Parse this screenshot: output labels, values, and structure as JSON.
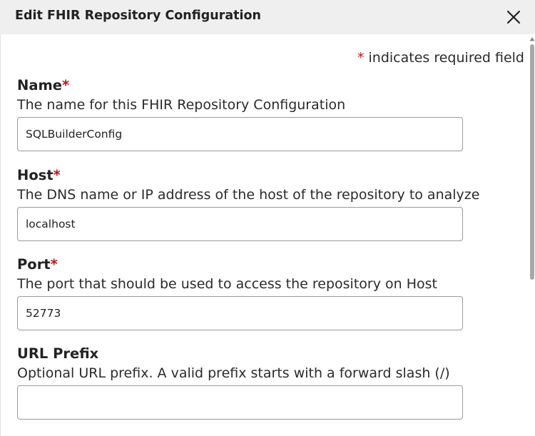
{
  "dialog": {
    "title": "Edit FHIR Repository Configuration",
    "close_icon": "close-icon"
  },
  "required_note": {
    "star": "*",
    "text": " indicates required field"
  },
  "fields": [
    {
      "label": "Name",
      "required_star": "*",
      "description": "The name for this FHIR Repository Configuration",
      "value": "SQLBuilderConfig"
    },
    {
      "label": "Host",
      "required_star": "*",
      "description": "The DNS name or IP address of the host of the repository to analyze",
      "value": "localhost"
    },
    {
      "label": "Port",
      "required_star": "*",
      "description": "The port that should be used to access the repository on Host",
      "value": "52773"
    },
    {
      "label": "URL Prefix",
      "required_star": "",
      "description": "Optional URL prefix. A valid prefix starts with a forward slash (/)",
      "value": ""
    }
  ],
  "colors": {
    "header_bg": "#efefef",
    "required_star": "#c0151a",
    "input_border": "#9a9a9a",
    "scrollbar_thumb": "#a8a8a8"
  }
}
